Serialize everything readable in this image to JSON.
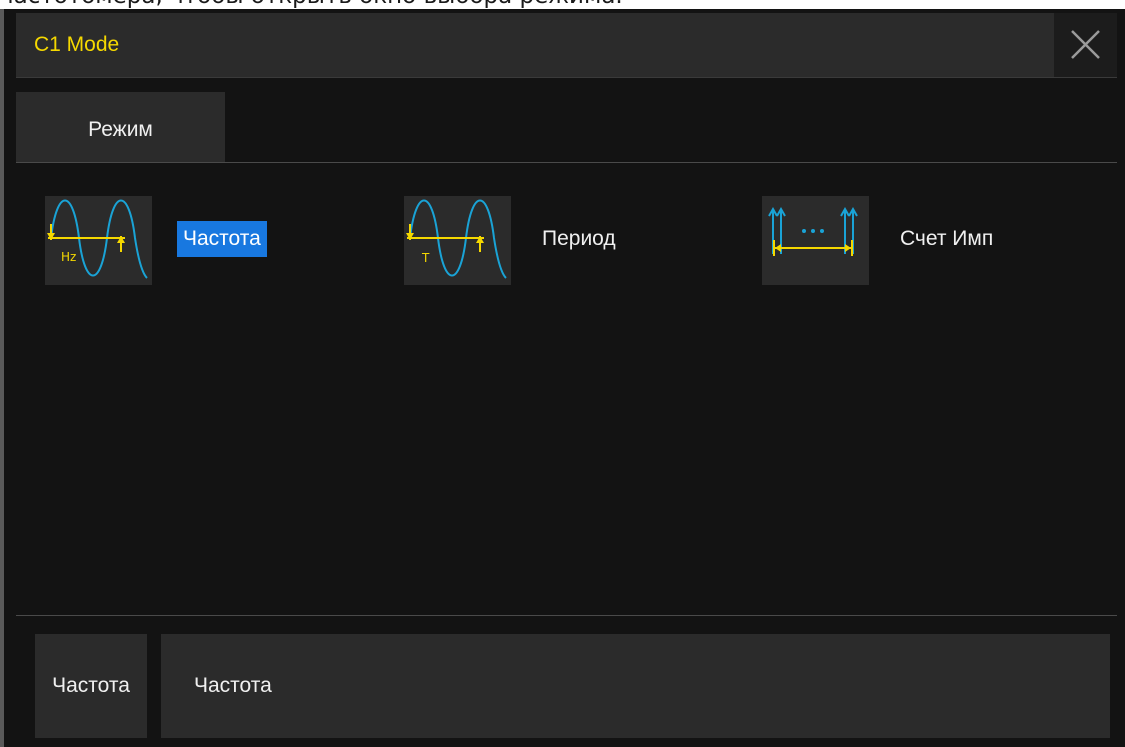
{
  "doc_fragment": "частотомера, чтобы открыть окно выбора режима.",
  "dialog": {
    "title": "C1 Mode",
    "close_icon": "close-icon"
  },
  "tabs": [
    {
      "label": "Режим",
      "active": true
    }
  ],
  "modes": [
    {
      "label": "Частота",
      "icon": "frequency-mode-icon",
      "icon_text": "Hz",
      "selected": true
    },
    {
      "label": "Период",
      "icon": "period-mode-icon",
      "icon_text": "T",
      "selected": false
    },
    {
      "label": "Счет Имп",
      "icon": "pulse-count-mode-icon",
      "selected": false
    }
  ],
  "footer": {
    "param_name": "Частота",
    "param_value": "Частота"
  },
  "colors": {
    "title": "#f5d800",
    "selection": "#1878e0",
    "waveform": "#1aa3d6",
    "marker": "#f5d800",
    "panel": "#2b2b2b",
    "background": "#131313"
  }
}
